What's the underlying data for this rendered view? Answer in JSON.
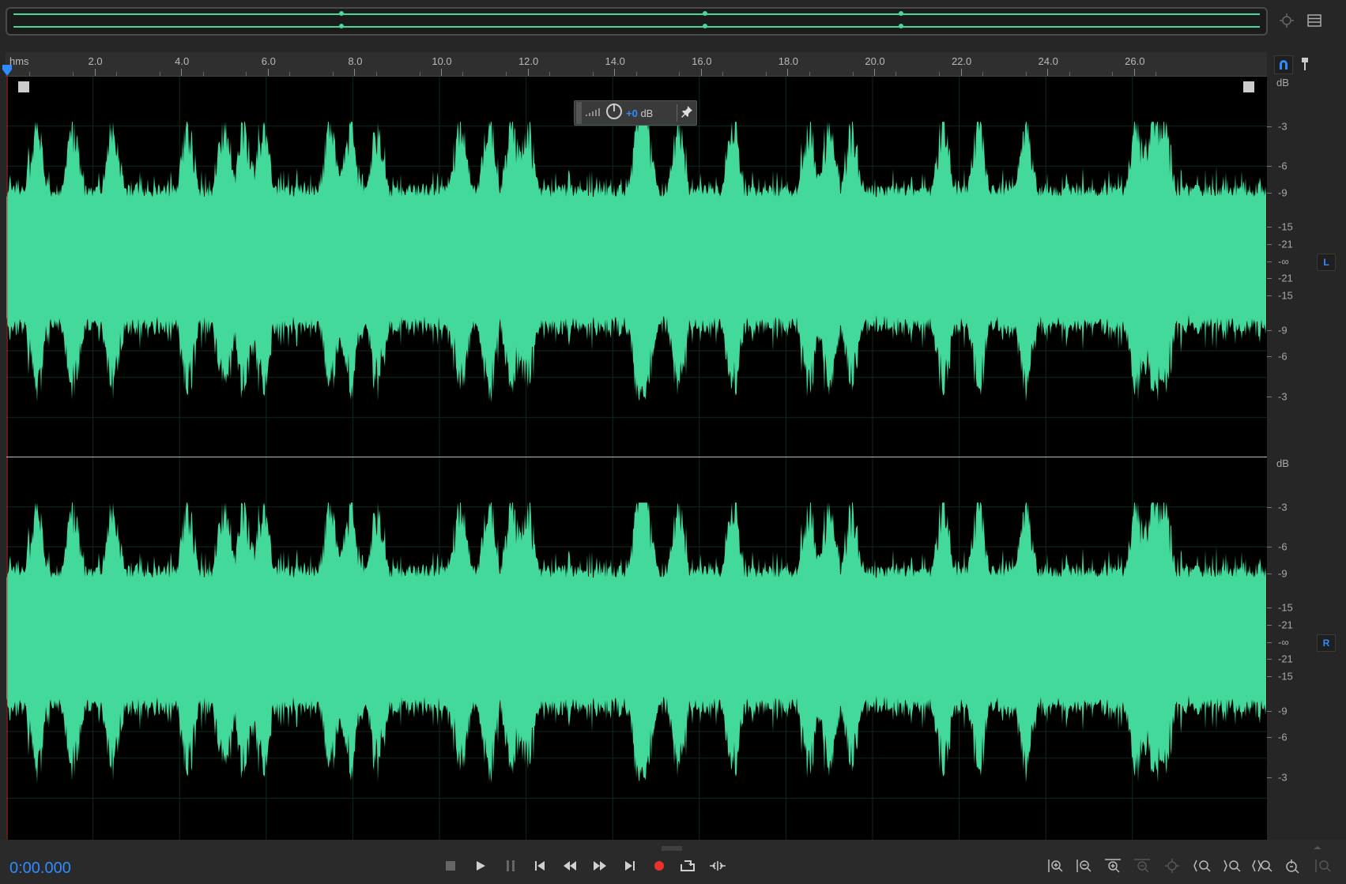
{
  "overview": {
    "label": "waveform-overview"
  },
  "ruler": {
    "unit_label": "hms",
    "ticks": [
      "2.0",
      "4.0",
      "6.0",
      "8.0",
      "10.0",
      "12.0",
      "14.0",
      "16.0",
      "18.0",
      "20.0",
      "22.0",
      "24.0",
      "26.0"
    ]
  },
  "hud": {
    "value": "+0",
    "unit": " dB"
  },
  "channels": [
    {
      "tag": "L",
      "db_head": "dB",
      "db_labels": [
        "-3",
        "-6",
        "-9",
        "-15",
        "-21",
        "-∞",
        "-21",
        "-15",
        "-9",
        "-6",
        "-3"
      ]
    },
    {
      "tag": "R",
      "db_head": "dB",
      "db_labels": [
        "-3",
        "-6",
        "-9",
        "-15",
        "-21",
        "-∞",
        "-21",
        "-15",
        "-9",
        "-6",
        "-3"
      ]
    }
  ],
  "transport": {
    "time": "0:00.000"
  },
  "colors": {
    "waveform": "#43d99a",
    "accent": "#2f8cff",
    "record": "#e8322d"
  }
}
